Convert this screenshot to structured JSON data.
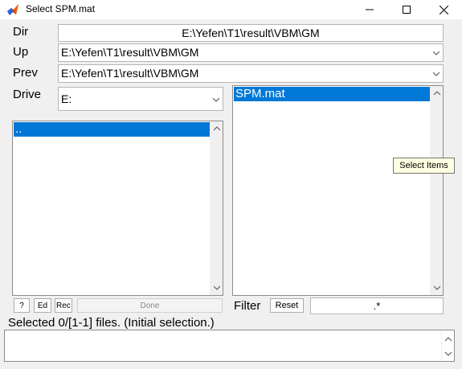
{
  "window": {
    "title": "Select SPM.mat",
    "icon": "matlab-icon",
    "controls": [
      "minimize-icon",
      "maximize-icon",
      "close-icon"
    ]
  },
  "dir": {
    "label": "Dir",
    "value": "E:\\Yefen\\T1\\result\\VBM\\GM"
  },
  "up": {
    "label": "Up",
    "value": "E:\\Yefen\\T1\\result\\VBM\\GM"
  },
  "prev": {
    "label": "Prev",
    "value": "E:\\Yefen\\T1\\result\\VBM\\GM"
  },
  "drive": {
    "label": "Drive",
    "value": "E:"
  },
  "dir_list": {
    "items": [
      ".."
    ],
    "selected_index": 0
  },
  "file_list": {
    "items": [
      "SPM.mat"
    ],
    "selected_index": 0
  },
  "tooltip": "Select Items",
  "buttons": {
    "help": "?",
    "edit": "Ed",
    "rec": "Rec",
    "done": "Done",
    "reset": "Reset"
  },
  "filter": {
    "label": "Filter",
    "value": ".*"
  },
  "status": "Selected 0/[1-1] files. (Initial selection.)",
  "colors": {
    "selection": "#0078d7",
    "window_bg": "#f0f0f0",
    "tooltip_bg": "#ffffe1"
  }
}
